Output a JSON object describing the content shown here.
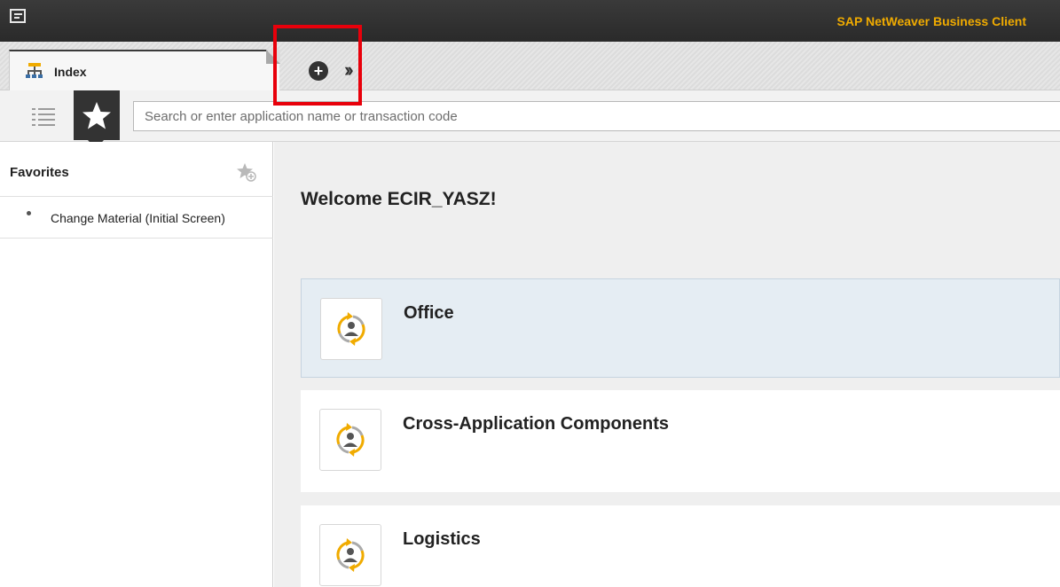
{
  "titlebar": {
    "app_title": "SAP NetWeaver Business Client",
    "accent_color": "#f0ab00",
    "menu_icon": "menu-icon"
  },
  "tabs": {
    "active_tab": {
      "label": "Index",
      "icon": "index-hierarchy-icon"
    },
    "new_tab_icon": "plus-circle-icon",
    "more_tabs_icon": "double-chevron-right-icon"
  },
  "toolbar": {
    "index_list_icon": "list-icon",
    "favorites_icon": "star-icon",
    "search_placeholder": "Search or enter application name or transaction code"
  },
  "sidebar": {
    "title": "Favorites",
    "add_favorite_icon": "star-add-icon",
    "items": [
      {
        "label": "Change Material (Initial Screen)"
      }
    ]
  },
  "main": {
    "welcome": "Welcome ECIR_YASZ!",
    "cards": [
      {
        "title": "Office",
        "icon": "workcenter-icon",
        "selected": true
      },
      {
        "title": "Cross-Application Components",
        "icon": "workcenter-icon",
        "selected": false
      },
      {
        "title": "Logistics",
        "icon": "workcenter-icon",
        "selected": false
      }
    ]
  },
  "colors": {
    "highlight": "#e8000b",
    "dark_header": "#2a2a2a",
    "selected_card": "#e5edf3"
  }
}
